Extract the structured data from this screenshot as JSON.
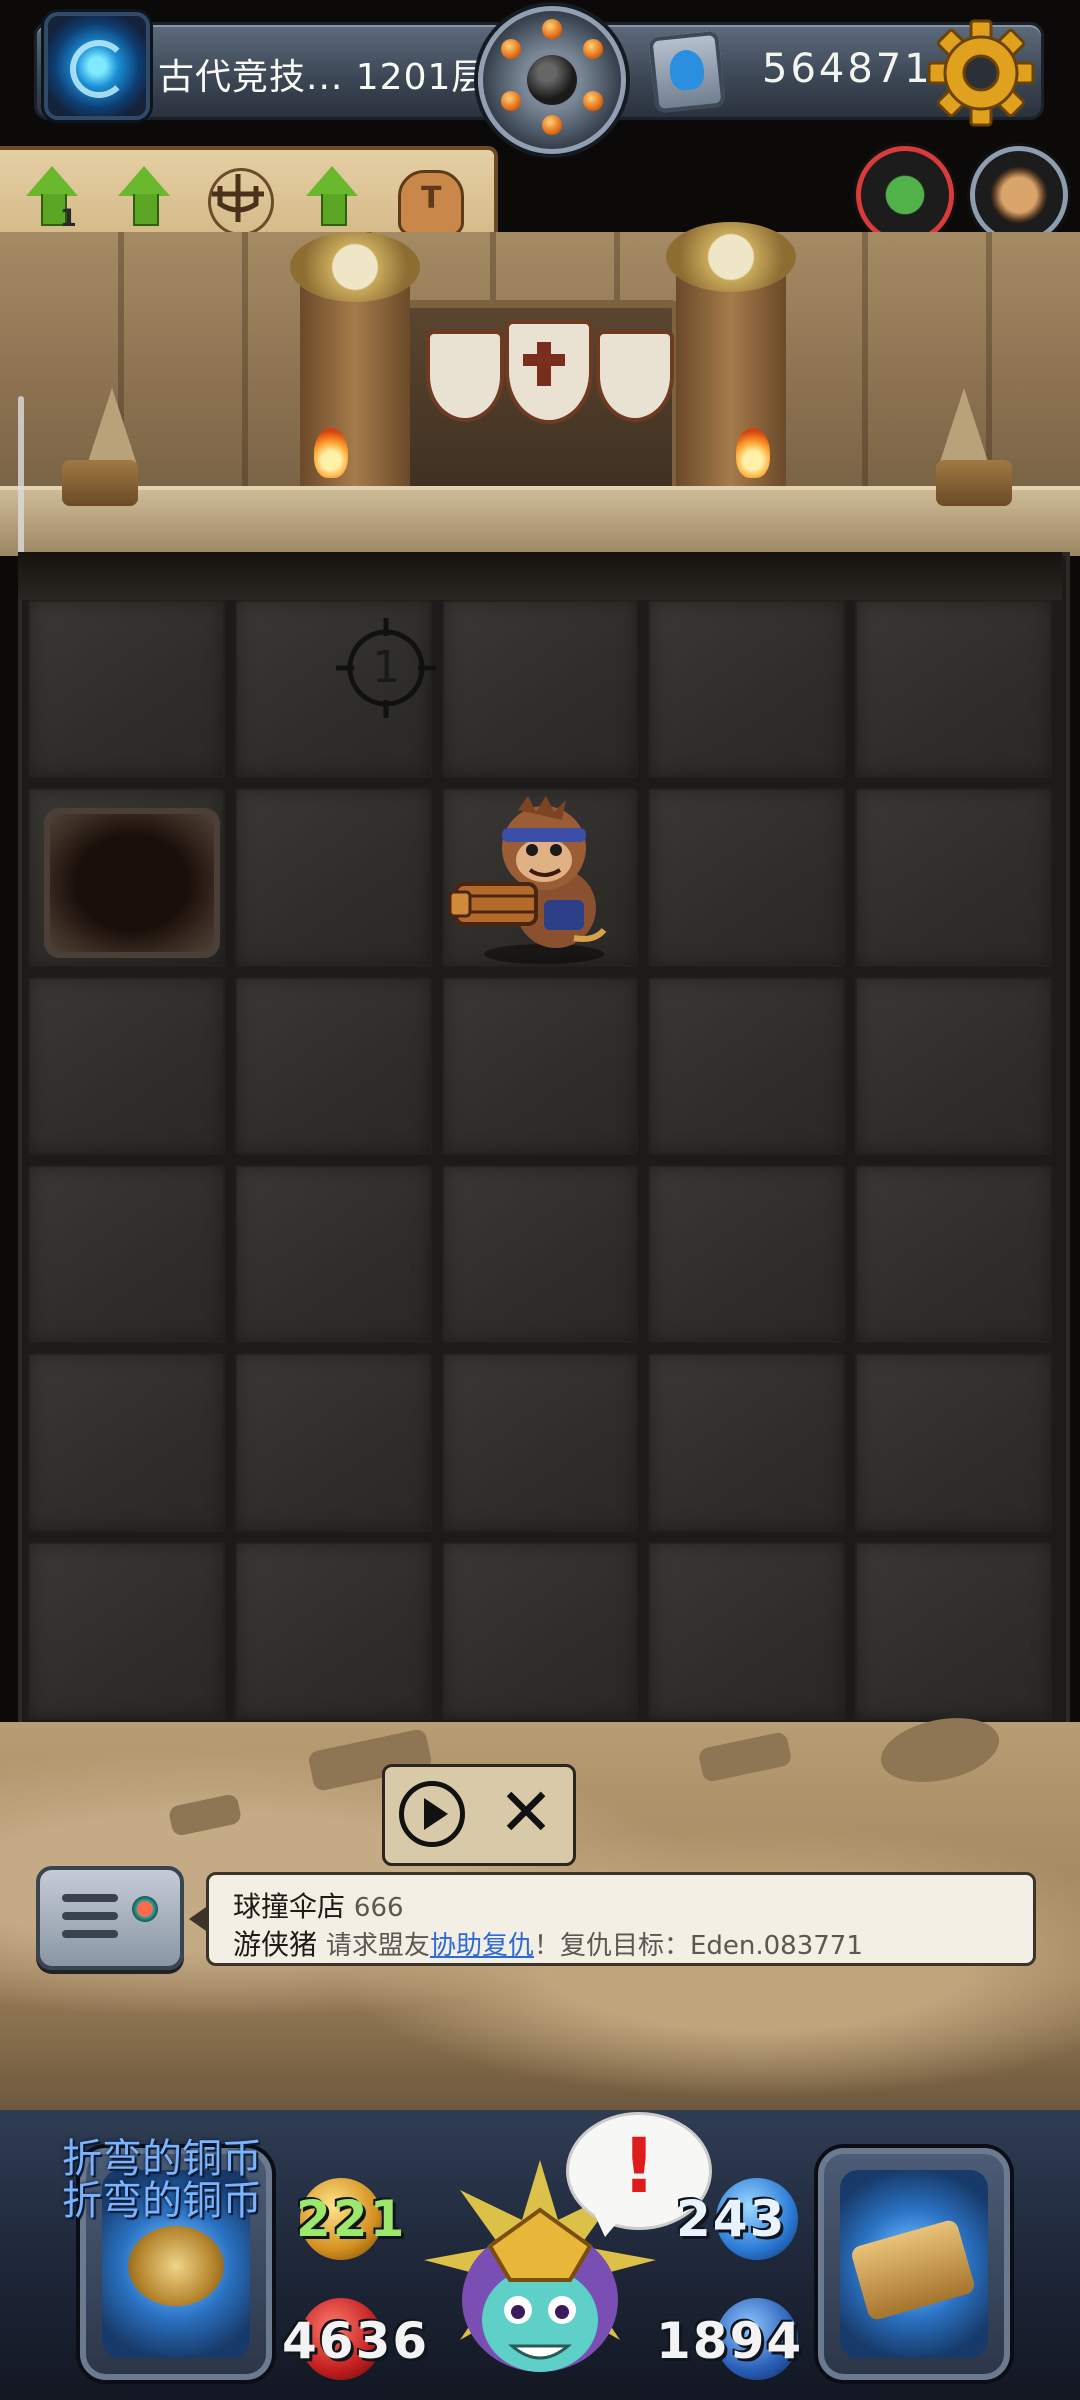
{
  "header": {
    "floor_label": "古代竞技... 1201层",
    "coins": "564871",
    "icons": [
      "portal-icon",
      "bomb-wheel-icon",
      "gem-icon",
      "gear-icon"
    ]
  },
  "buffs": [
    {
      "icon": "arrow-up-icon",
      "count": "1"
    },
    {
      "icon": "arrow-up-icon"
    },
    {
      "icon": "candelabra-sigil-icon"
    },
    {
      "icon": "arrow-up-icon"
    },
    {
      "icon": "stump-icon"
    }
  ],
  "board": {
    "columns": 5,
    "rows": 6,
    "target_marker": "1"
  },
  "controls": {
    "play_icon": "play-icon",
    "close_symbol": "✕"
  },
  "chat": {
    "line1_name": "球撞伞店",
    "line1_msg": "666",
    "line2_name": "游侠猪",
    "line2_prefix": "请求盟友",
    "line2_link": "协助复仇",
    "line2_suffix": "！复仇目标：Eden.083771"
  },
  "hud": {
    "player_name_1": "折弯的铜币",
    "player_name_2": "折弯的铜币",
    "attack": "221",
    "defense": "243",
    "hp": "4636",
    "gold": "1894",
    "alert": "!",
    "colors": {
      "attack": "#9be86a",
      "defense": "#e9f2ff",
      "hp": "#f3f3f3",
      "gold": "#f3f3f3"
    }
  }
}
